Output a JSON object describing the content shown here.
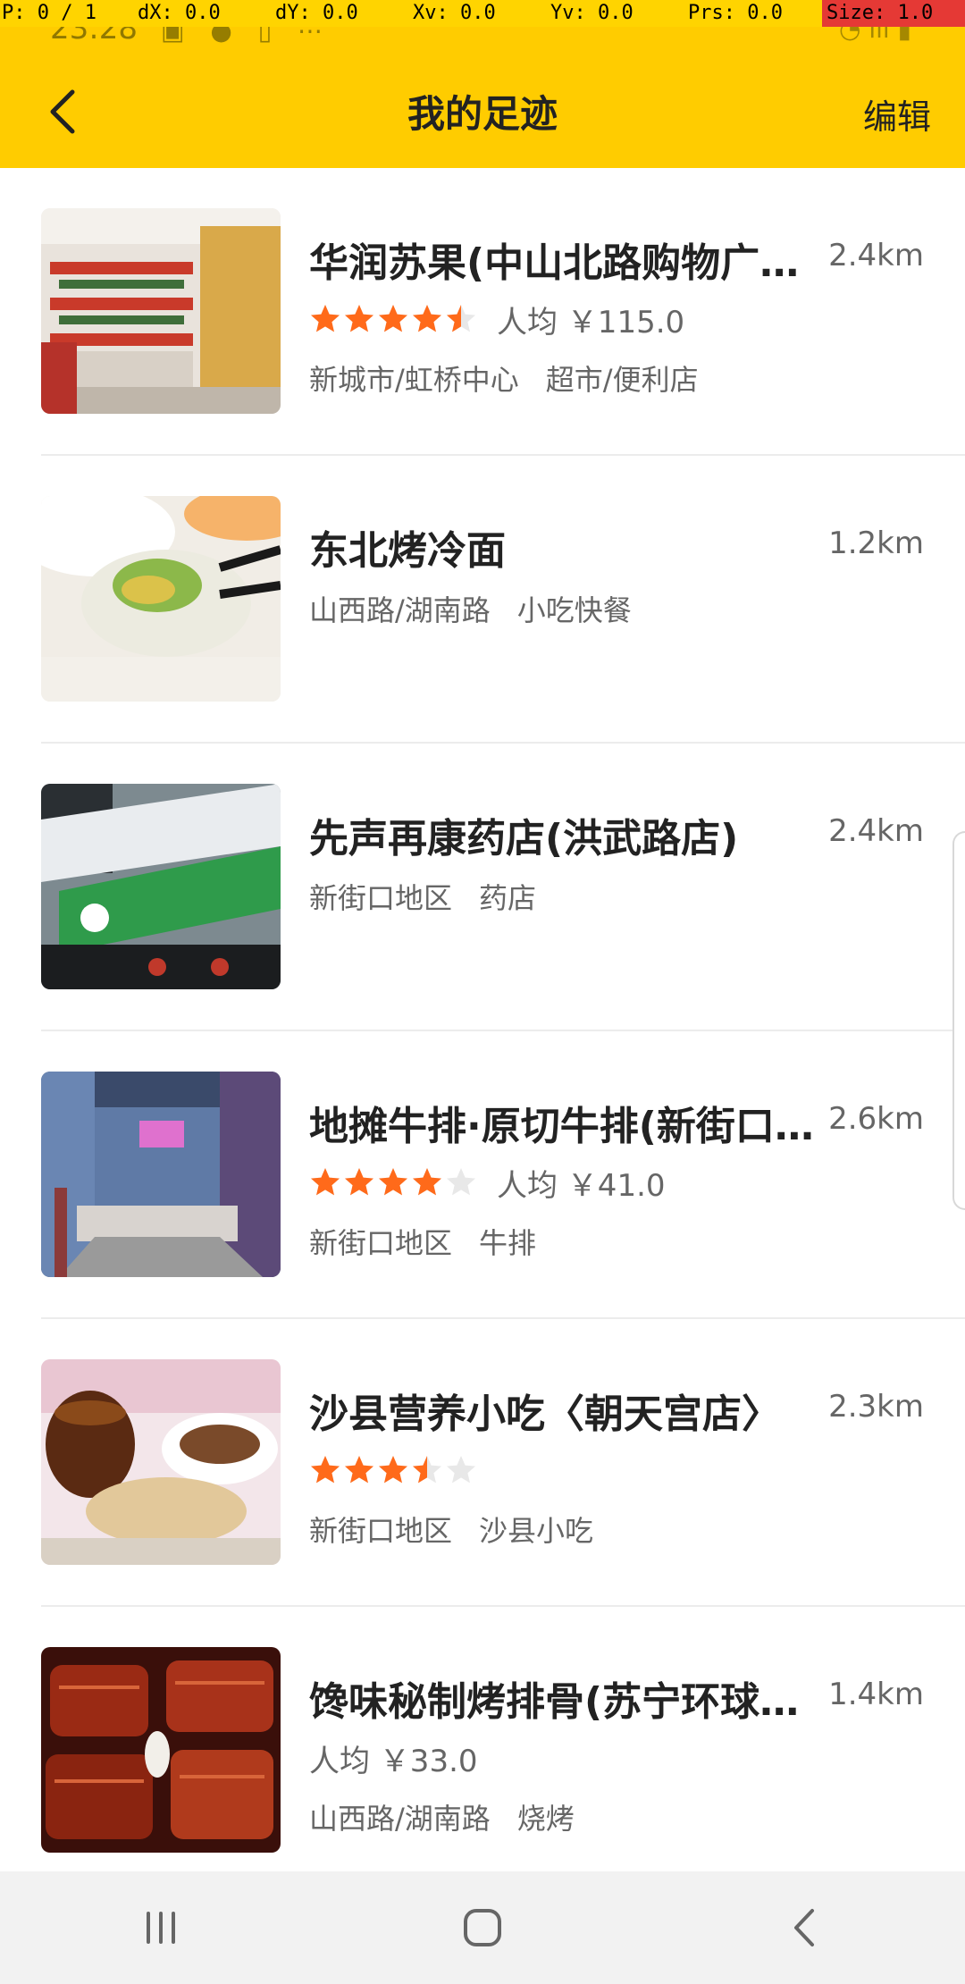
{
  "debug": {
    "p": "P: 0 / 1",
    "dx": "dX: 0.0",
    "dy": "dY: 0.0",
    "xv": "Xv: 0.0",
    "yv": "Yv: 0.0",
    "prs": "Prs: 0.0",
    "size": "Size: 1.0"
  },
  "status_bar": {
    "time": "23:28",
    "icons": [
      "photo-icon",
      "alert-icon",
      "sim-icon",
      "more-icon"
    ],
    "right_icons": [
      "wifi-icon",
      "signal-icon",
      "battery-icon"
    ]
  },
  "header": {
    "title": "我的足迹",
    "edit_label": "编辑",
    "back_icon": "chevron-left-icon",
    "background": "#ffcc00"
  },
  "colors": {
    "star_filled": "#ff6a1a",
    "star_empty": "#e8e8e8"
  },
  "items": [
    {
      "name": "华润苏果(中山北路购物广…",
      "distance": "2.4km",
      "rating": 4.5,
      "avg_price": "人均 ￥115.0",
      "area": "新城市/虹桥中心",
      "category": "超市/便利店"
    },
    {
      "name": "东北烤冷面",
      "distance": "1.2km",
      "area": "山西路/湖南路",
      "category": "小吃快餐"
    },
    {
      "name": "先声再康药店(洪武路店)",
      "distance": "2.4km",
      "area": "新街口地区",
      "category": "药店"
    },
    {
      "name": "地摊牛排·原切牛排(新街口…",
      "distance": "2.6km",
      "rating": 4.0,
      "avg_price": "人均 ￥41.0",
      "area": "新街口地区",
      "category": "牛排"
    },
    {
      "name": "沙县营养小吃〈朝天宫店〉",
      "distance": "2.3km",
      "rating": 3.5,
      "area": "新街口地区",
      "category": "沙县小吃"
    },
    {
      "name": "馋味秘制烤排骨(苏宁环球…",
      "distance": "1.4km",
      "avg_price": "人均 ￥33.0",
      "area": "山西路/湖南路",
      "category": "烧烤"
    }
  ],
  "navbar": {
    "buttons": [
      "recent-apps-icon",
      "home-icon",
      "back-icon"
    ]
  }
}
